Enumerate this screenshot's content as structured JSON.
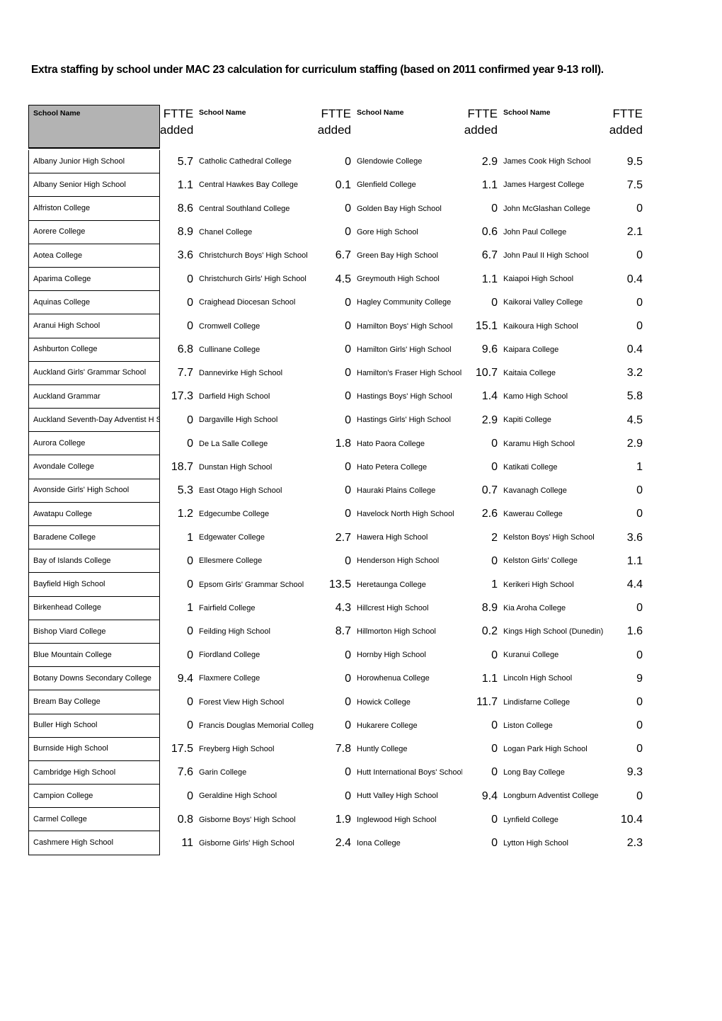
{
  "document": {
    "title": "Extra staffing by school under MAC 23 calculation for curriculum staffing (based on 2011 confirmed year 9-13 roll)."
  },
  "table": {
    "headers": {
      "school_name": "School Name",
      "ftte_line1": "FTTE",
      "ftte_line2": "added"
    },
    "columns": [
      {
        "id": "column-1",
        "header_name": "School Name",
        "header_value_line1": "FTTE",
        "header_value_line2": "added",
        "header_shaded": true,
        "rows": [
          {
            "name": "Albany Junior High School",
            "value": "5.7"
          },
          {
            "name": "Albany Senior High School",
            "value": "1.1"
          },
          {
            "name": "Alfriston College",
            "value": "8.6"
          },
          {
            "name": "Aorere College",
            "value": "8.9"
          },
          {
            "name": "Aotea College",
            "value": "3.6"
          },
          {
            "name": "Aparima College",
            "value": "0"
          },
          {
            "name": "Aquinas College",
            "value": "0"
          },
          {
            "name": "Aranui High School",
            "value": "0"
          },
          {
            "name": "Ashburton College",
            "value": "6.8"
          },
          {
            "name": "Auckland Girls' Grammar School",
            "value": "7.7"
          },
          {
            "name": "Auckland Grammar",
            "value": "17.3"
          },
          {
            "name": "Auckland Seventh-Day Adventist H S",
            "value": "0"
          },
          {
            "name": "Aurora College",
            "value": "0"
          },
          {
            "name": "Avondale College",
            "value": "18.7"
          },
          {
            "name": "Avonside Girls' High School",
            "value": "5.3"
          },
          {
            "name": "Awatapu College",
            "value": "1.2"
          },
          {
            "name": "Baradene College",
            "value": "1"
          },
          {
            "name": "Bay of Islands College",
            "value": "0"
          },
          {
            "name": "Bayfield High School",
            "value": "0"
          },
          {
            "name": "Birkenhead College",
            "value": "1"
          },
          {
            "name": "Bishop Viard College",
            "value": "0"
          },
          {
            "name": "Blue Mountain College",
            "value": "0"
          },
          {
            "name": "Botany Downs Secondary College",
            "value": "9.4"
          },
          {
            "name": "Bream Bay College",
            "value": "0"
          },
          {
            "name": "Buller High School",
            "value": "0"
          },
          {
            "name": "Burnside High School",
            "value": "17.5"
          },
          {
            "name": "Cambridge High School",
            "value": "7.6"
          },
          {
            "name": "Campion College",
            "value": "0"
          },
          {
            "name": "Carmel College",
            "value": "0.8"
          },
          {
            "name": "Cashmere High School",
            "value": "11"
          }
        ]
      },
      {
        "id": "column-2",
        "header_name": "School Name",
        "header_value_line1": "FTTE",
        "header_value_line2": "added",
        "header_shaded": false,
        "rows": [
          {
            "name": "Catholic Cathedral College",
            "value": "0"
          },
          {
            "name": "Central Hawkes Bay College",
            "value": "0.1"
          },
          {
            "name": "Central Southland College",
            "value": "0"
          },
          {
            "name": "Chanel College",
            "value": "0"
          },
          {
            "name": "Christchurch Boys' High School",
            "value": "6.7"
          },
          {
            "name": "Christchurch Girls' High School",
            "value": "4.5"
          },
          {
            "name": "Craighead Diocesan School",
            "value": "0"
          },
          {
            "name": "Cromwell College",
            "value": "0"
          },
          {
            "name": "Cullinane College",
            "value": "0"
          },
          {
            "name": "Dannevirke High School",
            "value": "0"
          },
          {
            "name": "Darfield High School",
            "value": "0"
          },
          {
            "name": "Dargaville High School",
            "value": "0"
          },
          {
            "name": "De La Salle College",
            "value": "1.8"
          },
          {
            "name": "Dunstan High School",
            "value": "0"
          },
          {
            "name": "East Otago High School",
            "value": "0"
          },
          {
            "name": "Edgecumbe College",
            "value": "0"
          },
          {
            "name": "Edgewater College",
            "value": "2.7"
          },
          {
            "name": "Ellesmere College",
            "value": "0"
          },
          {
            "name": "Epsom Girls' Grammar School",
            "value": "13.5"
          },
          {
            "name": "Fairfield College",
            "value": "4.3"
          },
          {
            "name": "Feilding High School",
            "value": "8.7"
          },
          {
            "name": "Fiordland College",
            "value": "0"
          },
          {
            "name": "Flaxmere College",
            "value": "0"
          },
          {
            "name": "Forest View High School",
            "value": "0"
          },
          {
            "name": "Francis Douglas Memorial College",
            "value": "0"
          },
          {
            "name": "Freyberg High School",
            "value": "7.8"
          },
          {
            "name": "Garin College",
            "value": "0"
          },
          {
            "name": "Geraldine High School",
            "value": "0"
          },
          {
            "name": "Gisborne Boys' High School",
            "value": "1.9"
          },
          {
            "name": "Gisborne Girls' High School",
            "value": "2.4"
          }
        ]
      },
      {
        "id": "column-3",
        "header_name": "School Name",
        "header_value_line1": "FTTE",
        "header_value_line2": "added",
        "header_shaded": false,
        "rows": [
          {
            "name": "Glendowie College",
            "value": "2.9"
          },
          {
            "name": "Glenfield College",
            "value": "1.1"
          },
          {
            "name": "Golden Bay High School",
            "value": "0"
          },
          {
            "name": "Gore High School",
            "value": "0.6"
          },
          {
            "name": "Green Bay High School",
            "value": "6.7"
          },
          {
            "name": "Greymouth High School",
            "value": "1.1"
          },
          {
            "name": "Hagley Community College",
            "value": "0"
          },
          {
            "name": "Hamilton Boys' High School",
            "value": "15.1"
          },
          {
            "name": "Hamilton Girls' High School",
            "value": "9.6"
          },
          {
            "name": "Hamilton's Fraser High School",
            "value": "10.7"
          },
          {
            "name": "Hastings Boys' High School",
            "value": "1.4"
          },
          {
            "name": "Hastings Girls' High School",
            "value": "2.9"
          },
          {
            "name": "Hato Paora College",
            "value": "0"
          },
          {
            "name": "Hato Petera College",
            "value": "0"
          },
          {
            "name": "Hauraki Plains College",
            "value": "0.7"
          },
          {
            "name": "Havelock North High School",
            "value": "2.6"
          },
          {
            "name": "Hawera High School",
            "value": "2"
          },
          {
            "name": "Henderson High School",
            "value": "0"
          },
          {
            "name": "Heretaunga College",
            "value": "1"
          },
          {
            "name": "Hillcrest High School",
            "value": "8.9"
          },
          {
            "name": "Hillmorton High School",
            "value": "0.2"
          },
          {
            "name": "Hornby High School",
            "value": "0"
          },
          {
            "name": "Horowhenua College",
            "value": "1.1"
          },
          {
            "name": "Howick College",
            "value": "11.7"
          },
          {
            "name": "Hukarere College",
            "value": "0"
          },
          {
            "name": "Huntly College",
            "value": "0"
          },
          {
            "name": "Hutt International Boys' School",
            "value": "0"
          },
          {
            "name": "Hutt Valley High School",
            "value": "9.4"
          },
          {
            "name": "Inglewood High School",
            "value": "0"
          },
          {
            "name": "Iona College",
            "value": "0"
          }
        ]
      },
      {
        "id": "column-4",
        "header_name": "School Name",
        "header_value_line1": "FTTE",
        "header_value_line2": "added",
        "header_shaded": false,
        "rows": [
          {
            "name": "James Cook High School",
            "value": "9.5"
          },
          {
            "name": "James Hargest College",
            "value": "7.5"
          },
          {
            "name": "John McGlashan College",
            "value": "0"
          },
          {
            "name": "John Paul College",
            "value": "2.1"
          },
          {
            "name": "John Paul II High School",
            "value": "0"
          },
          {
            "name": "Kaiapoi High School",
            "value": "0.4"
          },
          {
            "name": "Kaikorai Valley College",
            "value": "0"
          },
          {
            "name": "Kaikoura High School",
            "value": "0"
          },
          {
            "name": "Kaipara College",
            "value": "0.4"
          },
          {
            "name": "Kaitaia College",
            "value": "3.2"
          },
          {
            "name": "Kamo High School",
            "value": "5.8"
          },
          {
            "name": "Kapiti College",
            "value": "4.5"
          },
          {
            "name": "Karamu High School",
            "value": "2.9"
          },
          {
            "name": "Katikati College",
            "value": "1"
          },
          {
            "name": "Kavanagh College",
            "value": "0"
          },
          {
            "name": "Kawerau College",
            "value": "0"
          },
          {
            "name": "Kelston Boys' High School",
            "value": "3.6"
          },
          {
            "name": "Kelston Girls' College",
            "value": "1.1"
          },
          {
            "name": "Kerikeri High School",
            "value": "4.4"
          },
          {
            "name": "Kia Aroha College",
            "value": "0"
          },
          {
            "name": "Kings High School (Dunedin)",
            "value": "1.6"
          },
          {
            "name": "Kuranui College",
            "value": "0"
          },
          {
            "name": "Lincoln High School",
            "value": "9"
          },
          {
            "name": "Lindisfarne College",
            "value": "0"
          },
          {
            "name": "Liston College",
            "value": "0"
          },
          {
            "name": "Logan Park High School",
            "value": "0"
          },
          {
            "name": "Long Bay College",
            "value": "9.3"
          },
          {
            "name": "Longburn Adventist College",
            "value": "0"
          },
          {
            "name": "Lynfield College",
            "value": "10.4"
          },
          {
            "name": "Lytton High School",
            "value": "2.3"
          }
        ]
      }
    ]
  },
  "colors": {
    "header_shade": "#b3b3b3",
    "border": "#000000",
    "text": "#000000",
    "background": "#ffffff"
  }
}
